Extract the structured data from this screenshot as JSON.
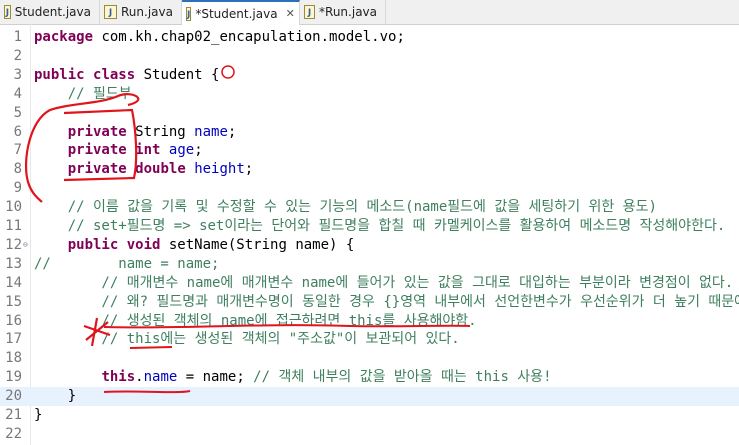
{
  "tabs": [
    {
      "label": "Student.java",
      "active": false,
      "close": ""
    },
    {
      "label": "Run.java",
      "active": false,
      "close": ""
    },
    {
      "label": "*Student.java",
      "active": true,
      "close": "✕"
    },
    {
      "label": "*Run.java",
      "active": false,
      "close": ""
    }
  ],
  "lines": [
    {
      "n": "1",
      "segs": [
        {
          "t": "package",
          "c": "kw"
        },
        {
          "t": " com.kh.chap02_encapulation.model.vo;",
          "c": ""
        }
      ]
    },
    {
      "n": "2",
      "segs": []
    },
    {
      "n": "3",
      "segs": [
        {
          "t": "public",
          "c": "kw"
        },
        {
          "t": " ",
          "c": ""
        },
        {
          "t": "class",
          "c": "kw"
        },
        {
          "t": " Student {",
          "c": ""
        }
      ]
    },
    {
      "n": "4",
      "segs": [
        {
          "t": "    // 필드부",
          "c": "cm"
        }
      ]
    },
    {
      "n": "5",
      "segs": []
    },
    {
      "n": "6",
      "segs": [
        {
          "t": "    ",
          "c": ""
        },
        {
          "t": "private",
          "c": "kw"
        },
        {
          "t": " String ",
          "c": ""
        },
        {
          "t": "name",
          "c": "fd"
        },
        {
          "t": ";",
          "c": ""
        }
      ]
    },
    {
      "n": "7",
      "segs": [
        {
          "t": "    ",
          "c": ""
        },
        {
          "t": "private",
          "c": "kw"
        },
        {
          "t": " ",
          "c": ""
        },
        {
          "t": "int",
          "c": "kw"
        },
        {
          "t": " ",
          "c": ""
        },
        {
          "t": "age",
          "c": "fd"
        },
        {
          "t": ";",
          "c": ""
        }
      ]
    },
    {
      "n": "8",
      "segs": [
        {
          "t": "    ",
          "c": ""
        },
        {
          "t": "private",
          "c": "kw"
        },
        {
          "t": " ",
          "c": ""
        },
        {
          "t": "double",
          "c": "kw"
        },
        {
          "t": " ",
          "c": ""
        },
        {
          "t": "height",
          "c": "fd"
        },
        {
          "t": ";",
          "c": ""
        }
      ]
    },
    {
      "n": "9",
      "segs": []
    },
    {
      "n": "10",
      "segs": [
        {
          "t": "    // 이름 값을 기록 및 수정할 수 있는 기능의 메소드(name필드에 값을 세팅하기 위한 용도)",
          "c": "cm"
        }
      ]
    },
    {
      "n": "11",
      "segs": [
        {
          "t": "    // set+필드명 => set이라는 단어와 필드명을 합칠 때 카멜케이스를 활용하여 메소드명 작성해야한다.",
          "c": "cm"
        }
      ]
    },
    {
      "n": "12",
      "fold": "⊖",
      "segs": [
        {
          "t": "    ",
          "c": ""
        },
        {
          "t": "public",
          "c": "kw"
        },
        {
          "t": " ",
          "c": ""
        },
        {
          "t": "void",
          "c": "kw"
        },
        {
          "t": " setName(String name) {",
          "c": ""
        }
      ]
    },
    {
      "n": "13",
      "segs": [
        {
          "t": "//        name = name;",
          "c": "cm"
        }
      ]
    },
    {
      "n": "14",
      "segs": [
        {
          "t": "        // 매개변수 name에 매개변수 name에 들어가 있는 값을 그대로 대입하는 부분이라 변경점이 없다.",
          "c": "cm"
        }
      ]
    },
    {
      "n": "15",
      "segs": [
        {
          "t": "        // 왜? 필드명과 매개변수명이 동일한 경우 {}영역 내부에서 선언한변수가 우선순위가 더 높기 때문에",
          "c": "cm"
        }
      ]
    },
    {
      "n": "16",
      "segs": [
        {
          "t": "        // 생성된 객체의 name에 접근하려면 this를 사용해야함.",
          "c": "cm"
        }
      ]
    },
    {
      "n": "17",
      "segs": [
        {
          "t": "        // this에는 생성된 객체의 \"주소값\"이 보관되어 있다.",
          "c": "cm"
        }
      ]
    },
    {
      "n": "18",
      "segs": []
    },
    {
      "n": "19",
      "segs": [
        {
          "t": "        ",
          "c": ""
        },
        {
          "t": "this",
          "c": "kw"
        },
        {
          "t": ".",
          "c": ""
        },
        {
          "t": "name",
          "c": "fd"
        },
        {
          "t": " = name; ",
          "c": ""
        },
        {
          "t": "// 객체 내부의 값을 받아올 때는 this 사용!",
          "c": "cm"
        }
      ]
    },
    {
      "n": "20",
      "segs": [
        {
          "t": "    }",
          "c": ""
        }
      ]
    },
    {
      "n": "21",
      "segs": [
        {
          "t": "}",
          "c": ""
        }
      ]
    },
    {
      "n": "22",
      "segs": []
    }
  ],
  "highlight_line": "20"
}
